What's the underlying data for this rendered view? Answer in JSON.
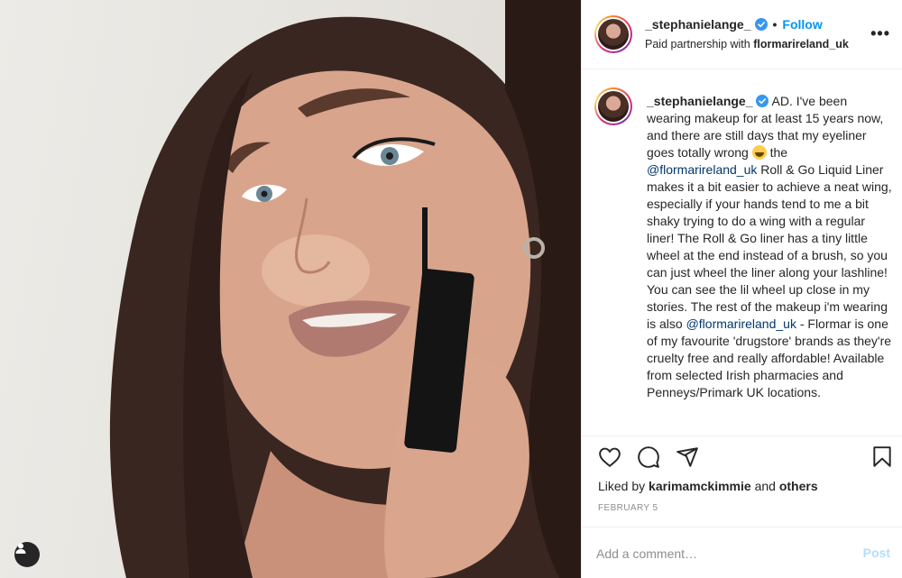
{
  "post": {
    "username": "_stephanielange_",
    "separator": "•",
    "follow_label": "Follow",
    "partner_prefix": "Paid partnership with",
    "partner_brand": "flormarireland_uk",
    "more_label": "•••"
  },
  "caption": {
    "username": "_stephanielange_",
    "part1": "AD. I've been wearing makeup for at least 15 years now, and there are still days that my eyeliner goes totally wrong",
    "emoji_name": "grinning-squinting-face-emoji",
    "part2": "the",
    "mention1": "@flormarireland_uk",
    "part3": "Roll & Go Liquid Liner makes it a bit easier to achieve a neat wing, especially if your hands tend to me a bit shaky trying to do a wing with a regular liner! The Roll & Go liner has a tiny little wheel at the end instead of a brush, so you can just wheel the liner along your lashline! You can see the lil wheel up close in my stories. The rest of the makeup i'm wearing is also",
    "mention2": "@flormarireland_uk",
    "part4": "- Flormar is one of my favourite 'drugstore' brands as they're cruelty free and really affordable! Available from selected Irish pharmacies and Penneys/Primark UK locations."
  },
  "actions": {
    "icons": [
      "heart-icon",
      "comment-icon",
      "share-icon",
      "bookmark-icon"
    ]
  },
  "likes": {
    "prefix": "Liked by",
    "user": "karimamckimmie",
    "joiner": "and",
    "others": "others"
  },
  "date": "February 5",
  "comment": {
    "placeholder": "Add a comment…",
    "post_label": "Post"
  },
  "colors": {
    "follow_blue": "#0095f6",
    "mention_blue": "#00376b",
    "post_disabled": "#b2dffc",
    "verified_blue": "#3897f0"
  }
}
